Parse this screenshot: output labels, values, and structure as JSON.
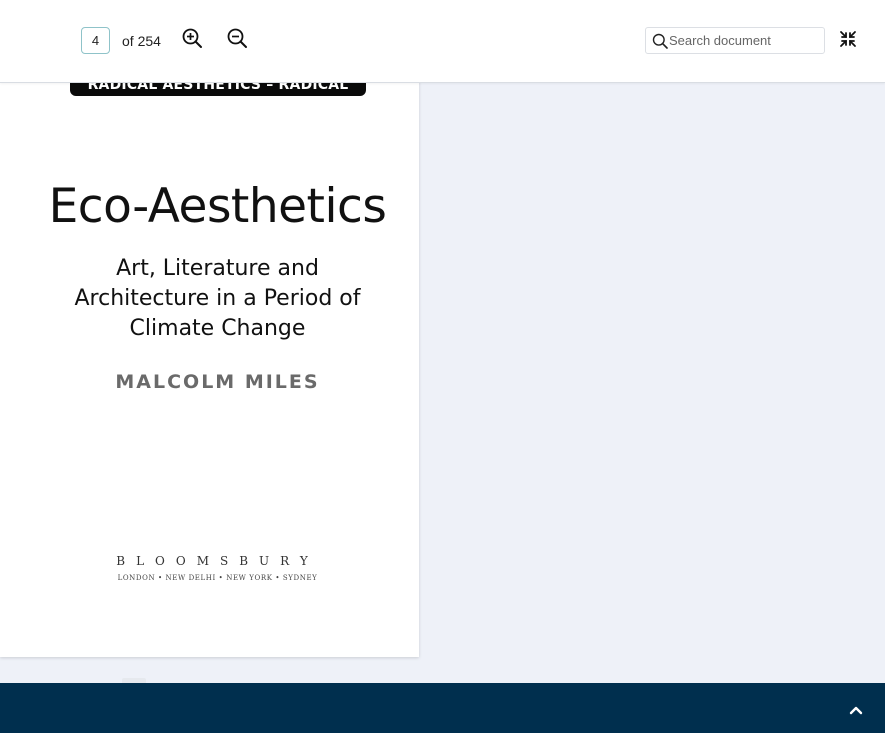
{
  "toolbar": {
    "current_page": "4",
    "page_count_label": "of 254",
    "zoom_in_icon": "zoom-in-icon",
    "zoom_out_icon": "zoom-out-icon",
    "search_placeholder": "Search document",
    "collapse_icon": "collapse-icon"
  },
  "document_page": {
    "series_banner": "RADICAL AESTHETICS – RADICAL ART",
    "title": "Eco-Aesthetics",
    "subtitle": "Art, Literature and Architecture in a Period of Climate Change",
    "author": "MALCOLM MILES",
    "publisher": "BLOOMSBURY",
    "publisher_cities": "LONDON • NEW DELHI • NEW YORK • SYDNEY"
  },
  "footer": {
    "scroll_top_icon": "chevron-up-icon"
  },
  "colors": {
    "accent_border": "#8fc3c9",
    "footer_background": "#002f4e",
    "viewer_background": "#eef1f8"
  }
}
